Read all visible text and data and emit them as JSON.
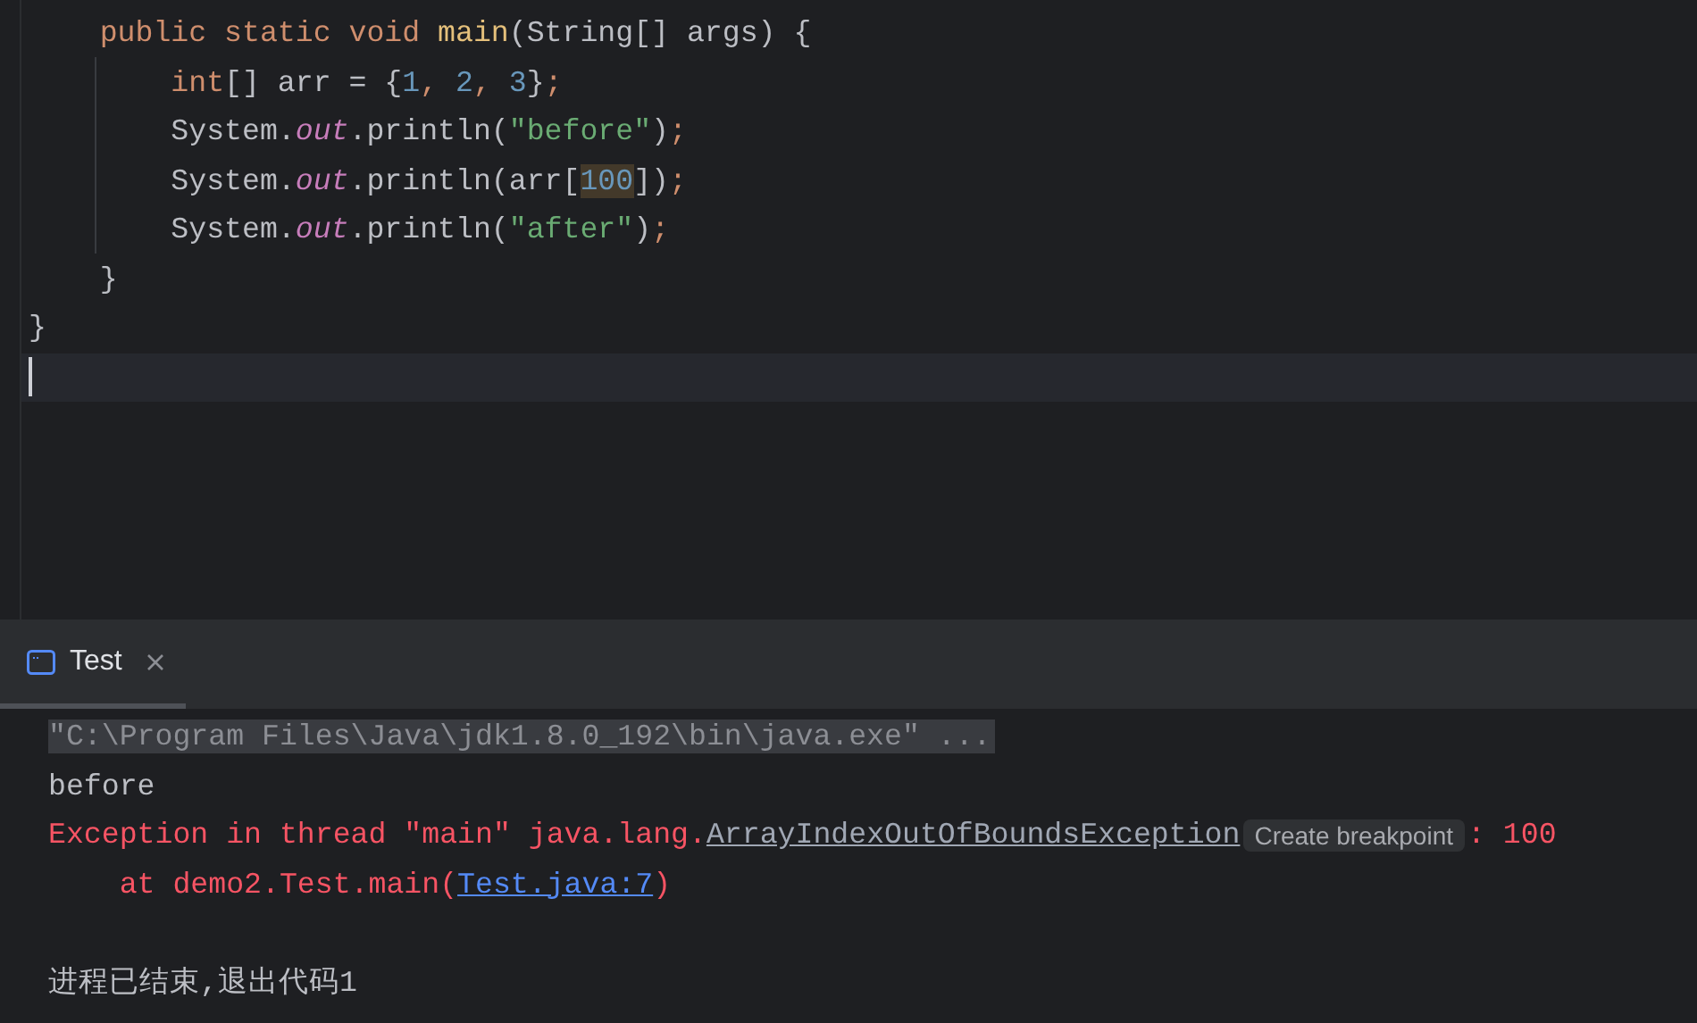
{
  "editor": {
    "lines": [
      {
        "current": false,
        "tokens": [
          {
            "kind": "keyword",
            "text": "    public static void "
          },
          {
            "kind": "function",
            "text": "main"
          },
          {
            "kind": "plain",
            "text": "(String[] args) {"
          }
        ]
      },
      {
        "current": false,
        "tokens": [
          {
            "kind": "keyword",
            "text": "        int"
          },
          {
            "kind": "plain",
            "text": "[] arr = {"
          },
          {
            "kind": "number",
            "text": "1"
          },
          {
            "kind": "keyword",
            "text": ", "
          },
          {
            "kind": "number",
            "text": "2"
          },
          {
            "kind": "keyword",
            "text": ", "
          },
          {
            "kind": "number",
            "text": "3"
          },
          {
            "kind": "plain",
            "text": "}"
          },
          {
            "kind": "keyword",
            "text": ";"
          }
        ]
      },
      {
        "current": false,
        "tokens": [
          {
            "kind": "plain",
            "text": "        System."
          },
          {
            "kind": "field",
            "text": "out"
          },
          {
            "kind": "plain",
            "text": ".println("
          },
          {
            "kind": "string",
            "text": "\"before\""
          },
          {
            "kind": "plain",
            "text": ")"
          },
          {
            "kind": "keyword",
            "text": ";"
          }
        ]
      },
      {
        "current": false,
        "tokens": [
          {
            "kind": "plain",
            "text": "        System."
          },
          {
            "kind": "field",
            "text": "out"
          },
          {
            "kind": "plain",
            "text": ".println(arr["
          },
          {
            "kind": "match",
            "text": "100"
          },
          {
            "kind": "plain",
            "text": "])"
          },
          {
            "kind": "keyword",
            "text": ";"
          }
        ]
      },
      {
        "current": false,
        "tokens": [
          {
            "kind": "plain",
            "text": "        System."
          },
          {
            "kind": "field",
            "text": "out"
          },
          {
            "kind": "plain",
            "text": ".println("
          },
          {
            "kind": "string",
            "text": "\"after\""
          },
          {
            "kind": "plain",
            "text": ")"
          },
          {
            "kind": "keyword",
            "text": ";"
          }
        ]
      },
      {
        "current": false,
        "tokens": [
          {
            "kind": "plain",
            "text": "    }"
          }
        ]
      },
      {
        "current": false,
        "tokens": [
          {
            "kind": "plain",
            "text": "}"
          }
        ]
      },
      {
        "current": true
      }
    ]
  },
  "run_panel": {
    "tabs": [
      {
        "label": "Test",
        "selected": true
      }
    ],
    "console": [
      {
        "kind": "command",
        "tokens": [
          {
            "kind": "text",
            "text": "\"C:\\Program Files\\Java\\jdk1.8.0_192\\bin\\java.exe\" ..."
          }
        ]
      },
      {
        "kind": "output",
        "tokens": [
          {
            "kind": "text",
            "text": "before"
          }
        ]
      },
      {
        "kind": "error",
        "tokens": [
          {
            "kind": "text",
            "text": "Exception in thread \"main\" java.lang."
          },
          {
            "kind": "class_link",
            "text": "ArrayIndexOutOfBoundsException"
          },
          {
            "kind": "hint",
            "text": "Create breakpoint"
          },
          {
            "kind": "text",
            "text": ": 100"
          }
        ]
      },
      {
        "kind": "error",
        "tokens": [
          {
            "kind": "text",
            "text": "    at demo2.Test.main("
          },
          {
            "kind": "file_link",
            "text": "Test.java:7"
          },
          {
            "kind": "text",
            "text": ")"
          }
        ]
      },
      {
        "kind": "blank"
      },
      {
        "kind": "output",
        "tokens": [
          {
            "kind": "text",
            "text": "进程已结束,退出代码1"
          }
        ]
      }
    ]
  }
}
